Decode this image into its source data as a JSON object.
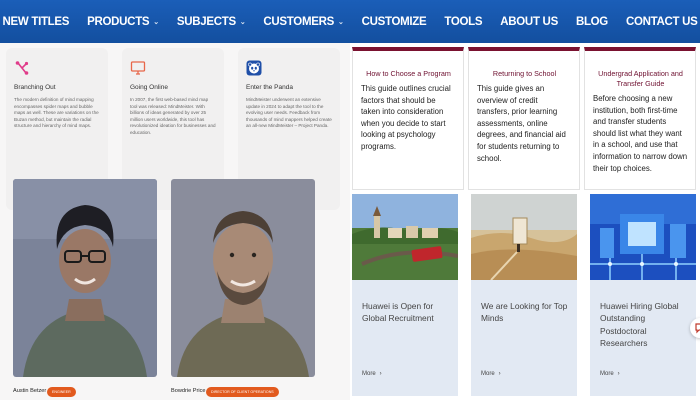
{
  "nav": {
    "items": [
      {
        "label": "NEW TITLES",
        "has_dropdown": false
      },
      {
        "label": "PRODUCTS",
        "has_dropdown": true
      },
      {
        "label": "SUBJECTS",
        "has_dropdown": true
      },
      {
        "label": "CUSTOMERS",
        "has_dropdown": true
      },
      {
        "label": "CUSTOMIZE",
        "has_dropdown": false
      },
      {
        "label": "TOOLS",
        "has_dropdown": false
      },
      {
        "label": "ABOUT US",
        "has_dropdown": false
      },
      {
        "label": "BLOG",
        "has_dropdown": false
      },
      {
        "label": "CONTACT US",
        "has_dropdown": false
      }
    ],
    "dropdown_icon": "chevron-down-icon"
  },
  "features": [
    {
      "icon": "branch-icon",
      "title": "Branching Out",
      "text": "The modern definition of mind mapping encompasses spider maps and bubble maps as well. These are variations on the Buzan method, but maintain the radial structure and hierarchy of mind maps."
    },
    {
      "icon": "monitor-icon",
      "title": "Going Online",
      "text": "In 2007, the first web-based mind map tool was released: MindMeister. With billions of ideas generated by over 25 million users worldwide, this tool has revolutionized ideation for businesses and education."
    },
    {
      "icon": "panda-icon",
      "title": "Enter the Panda",
      "text": "MindMeister underwent an extensive update in 2024 to adapt the tool to the evolving user needs. Feedback from thousands of mind mappers helped create an all-new MindMeister – Project Panda."
    }
  ],
  "people": [
    {
      "name": "Austin Betzer",
      "role": "Engineer"
    },
    {
      "name": "Bowdrie Price",
      "role": "Director of Client Operations"
    }
  ],
  "guides": [
    {
      "title": "How to Choose a Program",
      "text": "This guide outlines crucial factors that should be taken into consideration when you decide to start looking at psychology programs."
    },
    {
      "title": "Returning to School",
      "text": "This guide gives an overview of credit transfers, prior learning assessments, online degrees, and financial aid for students returning to school."
    },
    {
      "title": "Undergrad Application and Transfer Guide",
      "text": "Before choosing a new institution, both first-time and transfer students should list what they want in a school, and use that information to narrow down their top choices."
    }
  ],
  "news": [
    {
      "title": "Huawei is Open for Global Recruitment",
      "more": "More"
    },
    {
      "title": "We are Looking for Top Minds",
      "more": "More"
    },
    {
      "title": "Huawei Hiring Global Outstanding Postdoctoral Researchers",
      "more": "More"
    }
  ],
  "colors": {
    "nav_bg": "#1a5cb5",
    "guide_accent": "#7a1230",
    "badge": "#e25a1e",
    "news_bg": "#e2e9f3",
    "branch_icon": "#e03c8a",
    "monitor_icon": "#e8674a",
    "panda_icon": "#1f4fa8"
  }
}
